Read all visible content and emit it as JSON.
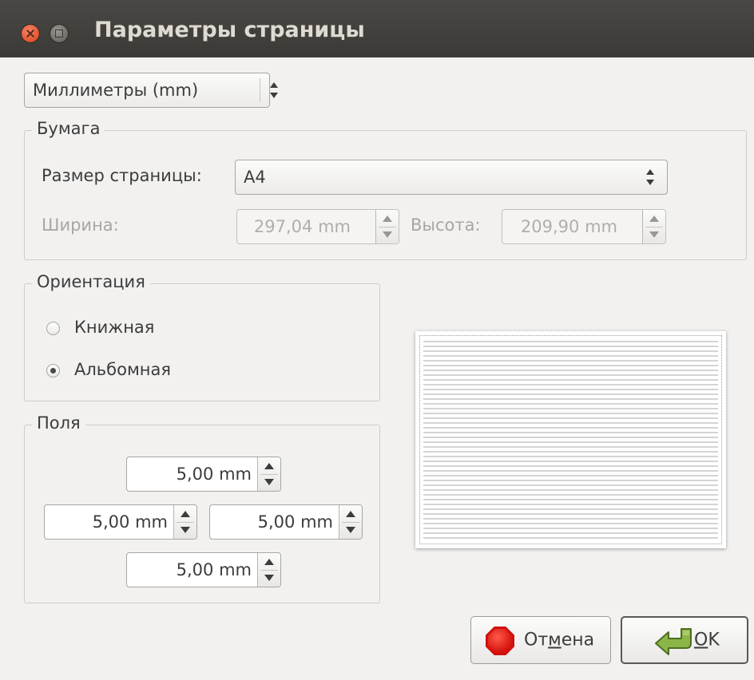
{
  "window": {
    "title": "Параметры страницы"
  },
  "units_combo": {
    "value": "Миллиметры (mm)"
  },
  "paper": {
    "legend": "Бумага",
    "size_label": "Размер страницы:",
    "size_value": "A4",
    "width_label": "Ширина:",
    "width_value": "297,04 mm",
    "height_label": "Высота:",
    "height_value": "209,90 mm"
  },
  "orientation": {
    "legend": "Ориентация",
    "portrait_label": "Книжная",
    "landscape_label": "Альбомная",
    "selected": "landscape"
  },
  "margins": {
    "legend": "Поля",
    "top": "5,00 mm",
    "left": "5,00 mm",
    "right": "5,00 mm",
    "bottom": "5,00 mm"
  },
  "buttons": {
    "cancel_pre": "От",
    "cancel_mn": "м",
    "cancel_post": "ена",
    "ok_mn": "O",
    "ok_post": "K"
  },
  "colors": {
    "titlebar": "#3b3a37",
    "close": "#e0532d",
    "cancel_icon": "#d01010",
    "ok_icon": "#7aa53a"
  }
}
